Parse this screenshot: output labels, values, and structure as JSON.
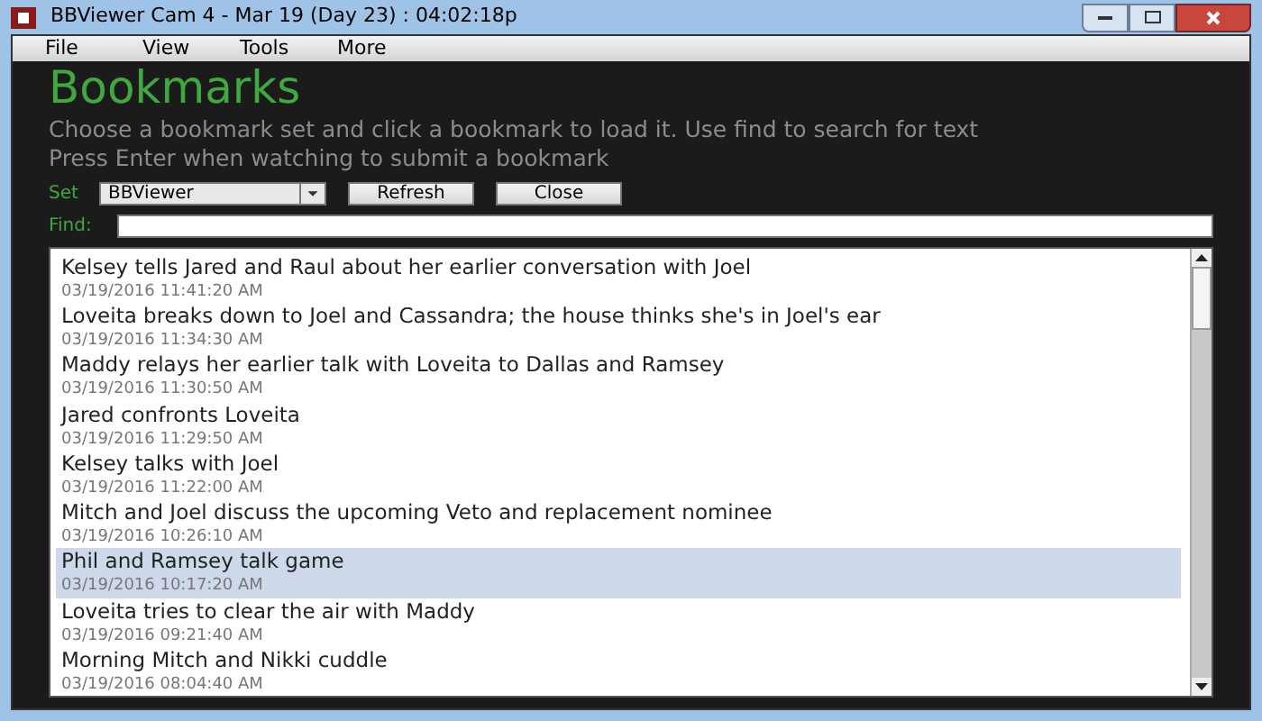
{
  "window": {
    "title": "BBViewer Cam 4 - Mar 19  (Day 23) : 04:02:18p"
  },
  "menu": [
    "File",
    "View",
    "Tools",
    "More"
  ],
  "heading": "Bookmarks",
  "instructions": [
    "Choose a bookmark set and click a bookmark to load it. Use find to search for text",
    "Press Enter when watching to submit a bookmark"
  ],
  "set": {
    "label": "Set",
    "value": "BBViewer"
  },
  "buttons": [
    "Refresh",
    "Close"
  ],
  "find": {
    "label": "Find:"
  },
  "bookmarks": [
    {
      "title": "Kelsey tells Jared and Raul about her earlier conversation with Joel",
      "time": "03/19/2016 11:41:20 AM",
      "selected": false
    },
    {
      "title": "Loveita breaks down to Joel and Cassandra; the house thinks she's in Joel's ear",
      "time": "03/19/2016 11:34:30 AM",
      "selected": false
    },
    {
      "title": "Maddy relays her earlier talk with Loveita to Dallas and Ramsey",
      "time": "03/19/2016 11:30:50 AM",
      "selected": false
    },
    {
      "title": "Jared confronts Loveita",
      "time": "03/19/2016 11:29:50 AM",
      "selected": false
    },
    {
      "title": "Kelsey talks with Joel",
      "time": "03/19/2016 11:22:00 AM",
      "selected": false
    },
    {
      "title": "Mitch and Joel discuss the upcoming Veto and replacement nominee",
      "time": "03/19/2016 10:26:10 AM",
      "selected": false
    },
    {
      "title": "Phil and Ramsey talk game",
      "time": "03/19/2016 10:17:20 AM",
      "selected": true
    },
    {
      "title": "Loveita tries to clear the air with Maddy",
      "time": "03/19/2016 09:21:40 AM",
      "selected": false
    },
    {
      "title": "Morning Mitch and Nikki cuddle",
      "time": "03/19/2016 08:04:40 AM",
      "selected": false
    }
  ]
}
